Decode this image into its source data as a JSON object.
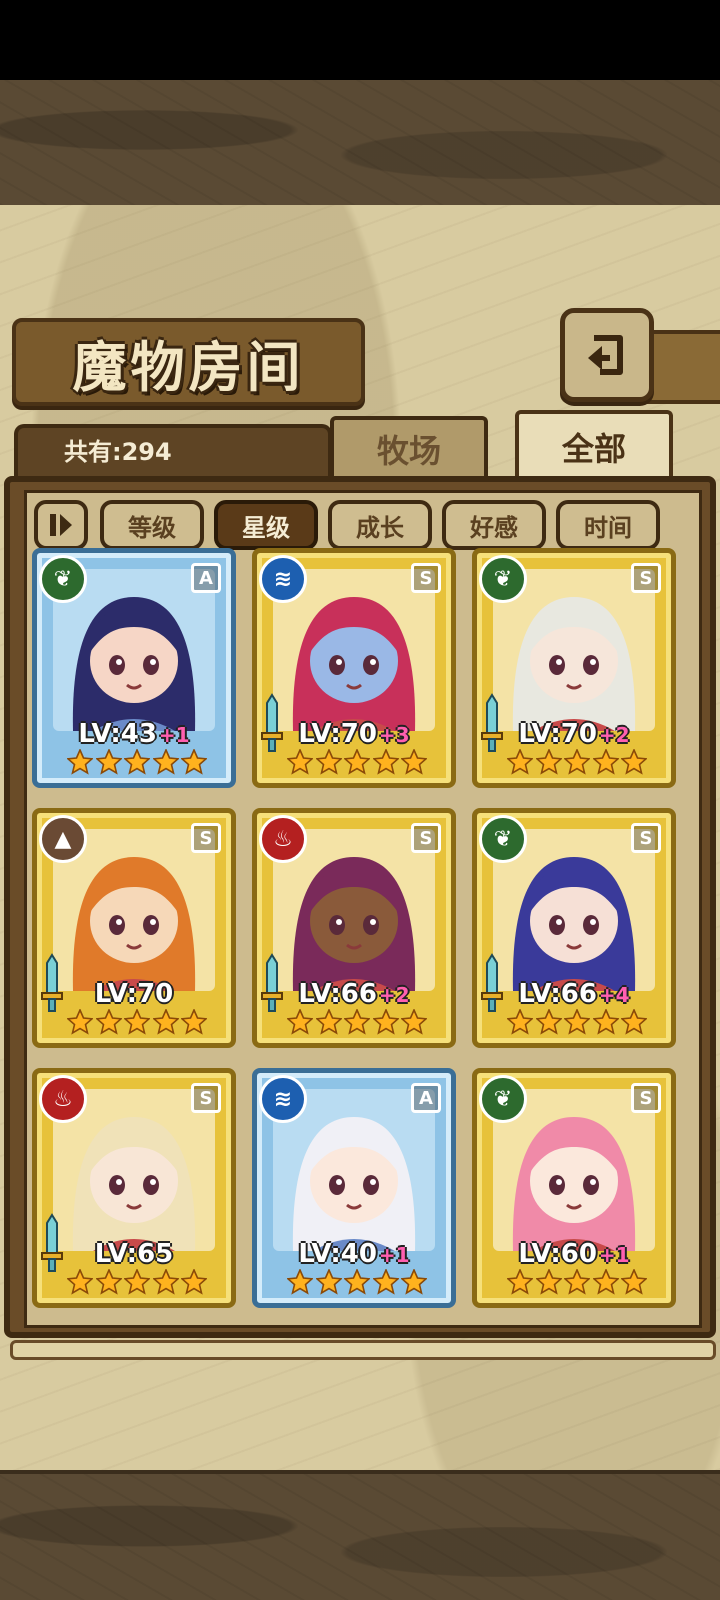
{
  "title": "魔物房间",
  "count_label": "共有:294",
  "tabs": [
    {
      "label": "牧场",
      "active": false
    },
    {
      "label": "全部",
      "active": true
    }
  ],
  "sort_buttons": [
    {
      "label": "等级",
      "active": false
    },
    {
      "label": "星级",
      "active": true
    },
    {
      "label": "成长",
      "active": false
    },
    {
      "label": "好感",
      "active": false
    },
    {
      "label": "时间",
      "active": false
    }
  ],
  "monsters": [
    {
      "element": "grass",
      "rank": "A",
      "frame": "blue",
      "level": "LV:43",
      "plus": "+1",
      "stars": 5,
      "has_sword": false,
      "hair": "#2c2c6a",
      "skin": "#f6d6c6"
    },
    {
      "element": "water",
      "rank": "S",
      "frame": "gold",
      "level": "LV:70",
      "plus": "+3",
      "stars": 5,
      "has_sword": true,
      "hair": "#c8305a",
      "skin": "#9ab8e6"
    },
    {
      "element": "grass",
      "rank": "S",
      "frame": "gold",
      "level": "LV:70",
      "plus": "+2",
      "stars": 5,
      "has_sword": true,
      "hair": "#e8e8e0",
      "skin": "#f6e6da"
    },
    {
      "element": "earth",
      "rank": "S",
      "frame": "gold",
      "level": "LV:70",
      "plus": "",
      "stars": 5,
      "has_sword": true,
      "hair": "#e07a2a",
      "skin": "#f6d8b8"
    },
    {
      "element": "fire",
      "rank": "S",
      "frame": "gold",
      "level": "LV:66",
      "plus": "+2",
      "stars": 5,
      "has_sword": true,
      "hair": "#7a2a5a",
      "skin": "#8a5a3a"
    },
    {
      "element": "grass",
      "rank": "S",
      "frame": "gold",
      "level": "LV:66",
      "plus": "+4",
      "stars": 5,
      "has_sword": true,
      "hair": "#3a3a9a",
      "skin": "#f6e0d6"
    },
    {
      "element": "fire",
      "rank": "S",
      "frame": "gold",
      "level": "LV:65",
      "plus": "",
      "stars": 5,
      "has_sword": true,
      "hair": "#f0e2b8",
      "skin": "#f8e6d6"
    },
    {
      "element": "water",
      "rank": "A",
      "frame": "blue",
      "level": "LV:40",
      "plus": "+1",
      "stars": 5,
      "has_sword": false,
      "hair": "#f0f0f6",
      "skin": "#fbe8dc"
    },
    {
      "element": "grass",
      "rank": "S",
      "frame": "gold",
      "level": "LV:60",
      "plus": "+1",
      "stars": 5,
      "has_sword": false,
      "hair": "#f08aa8",
      "skin": "#fbe8dc"
    }
  ],
  "colors": {
    "gold_frame": "#e7c23a",
    "blue_frame": "#8ec3e6",
    "level_plus": "#ff5fb0",
    "panel_brown": "#6a4c28"
  }
}
